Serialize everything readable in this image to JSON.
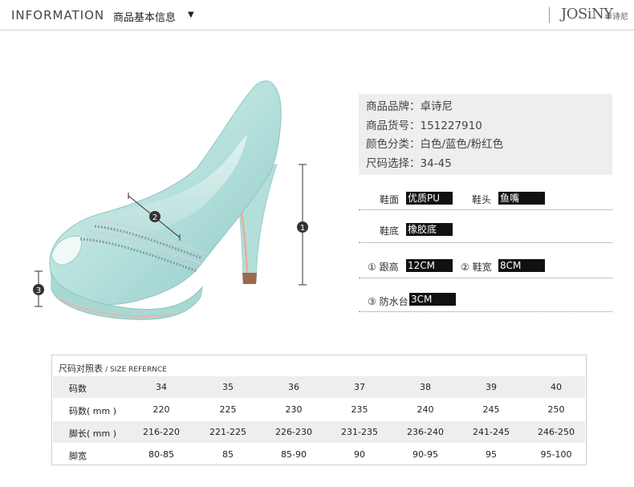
{
  "header": {
    "title_en": "INFORMATION",
    "title_cn": "商品基本信息",
    "caret": "▼",
    "brand_en": "JOSiNY",
    "brand_cn": "卓诗尼"
  },
  "product_image": {
    "markers": [
      "1",
      "2",
      "3"
    ],
    "shoe_color": "#bfe7e4"
  },
  "info": {
    "brand": "商品品牌：卓诗尼",
    "item_no": "商品货号：151227910",
    "colors": "颜色分类：白色/蓝色/粉红色",
    "sizes": "尺码选择：34-45"
  },
  "attributes": {
    "upper_label": "鞋面",
    "upper_value": "优质PU",
    "toe_label": "鞋头",
    "toe_value": "鱼嘴",
    "sole_label": "鞋底",
    "sole_value": "橡胶底",
    "heel_label": "① 跟高",
    "heel_value": "12CM",
    "width_label": "② 鞋宽",
    "width_value": "8CM",
    "platform_label": "③ 防水台",
    "platform_value": "3CM"
  },
  "size_table": {
    "title_cn": "尺码对照表",
    "title_en": "/ SIZE REFERNCE",
    "rows": [
      {
        "label": "码数",
        "cells": [
          "34",
          "35",
          "36",
          "37",
          "38",
          "39",
          "40"
        ]
      },
      {
        "label": "码数( mm )",
        "cells": [
          "220",
          "225",
          "230",
          "235",
          "240",
          "245",
          "250"
        ]
      },
      {
        "label": "脚长( mm )",
        "cells": [
          "216-220",
          "221-225",
          "226-230",
          "231-235",
          "236-240",
          "241-245",
          "246-250"
        ]
      },
      {
        "label": "脚宽",
        "cells": [
          "80-85",
          "85",
          "85-90",
          "90",
          "90-95",
          "95",
          "95-100"
        ]
      }
    ]
  }
}
